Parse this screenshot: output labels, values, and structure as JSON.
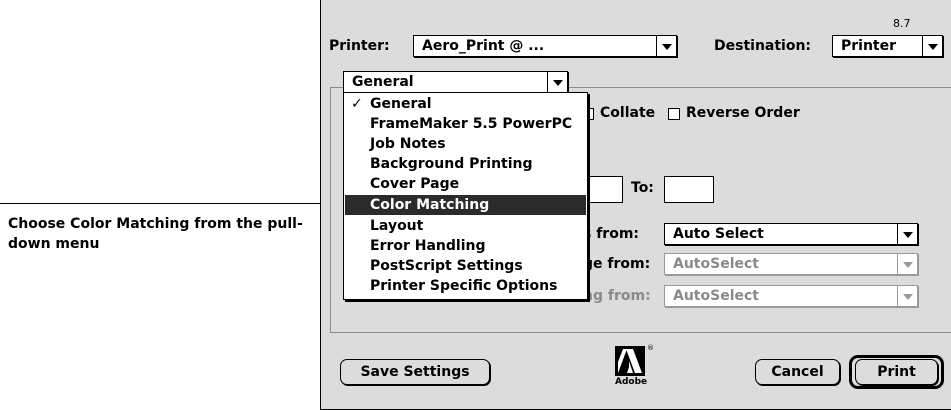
{
  "annotation": {
    "text": "Choose Color Matching from the pull-down menu"
  },
  "dialog": {
    "version": "8.7",
    "printer_label": "Printer:",
    "printer_value": "Aero_Print @ ...",
    "destination_label": "Destination:",
    "destination_value": "Printer",
    "section_popup": {
      "value": "General"
    },
    "collate_label": "Collate",
    "collate_checked": false,
    "reverse_order_label": "Reverse Order",
    "reverse_order_checked": false,
    "to_label": "To:",
    "paper_rows": [
      {
        "label_fragment": "s from:",
        "value": "Auto Select",
        "enabled": true
      },
      {
        "label_fragment": "ge from:",
        "value": "AutoSelect",
        "enabled": false
      },
      {
        "label_fragment": "ng from:",
        "value": "AutoSelect",
        "enabled": false
      }
    ],
    "save_settings_label": "Save Settings",
    "cancel_label": "Cancel",
    "print_label": "Print",
    "logo_text": "Adobe",
    "logo_mark": "®"
  },
  "menu": {
    "selected": "General",
    "checkmark": "✓",
    "highlighted": "Color Matching",
    "items": [
      "General",
      "FrameMaker 5.5 PowerPC",
      "Job Notes",
      "Background Printing",
      "Cover Page",
      "Color Matching",
      "Layout",
      "Error Handling",
      "PostScript Settings",
      "Printer Specific Options"
    ]
  },
  "colors": {
    "dialog_bg": "#dcdcdc",
    "highlight_bg": "#2b2b2b",
    "disabled_text": "#8a8a8a"
  }
}
